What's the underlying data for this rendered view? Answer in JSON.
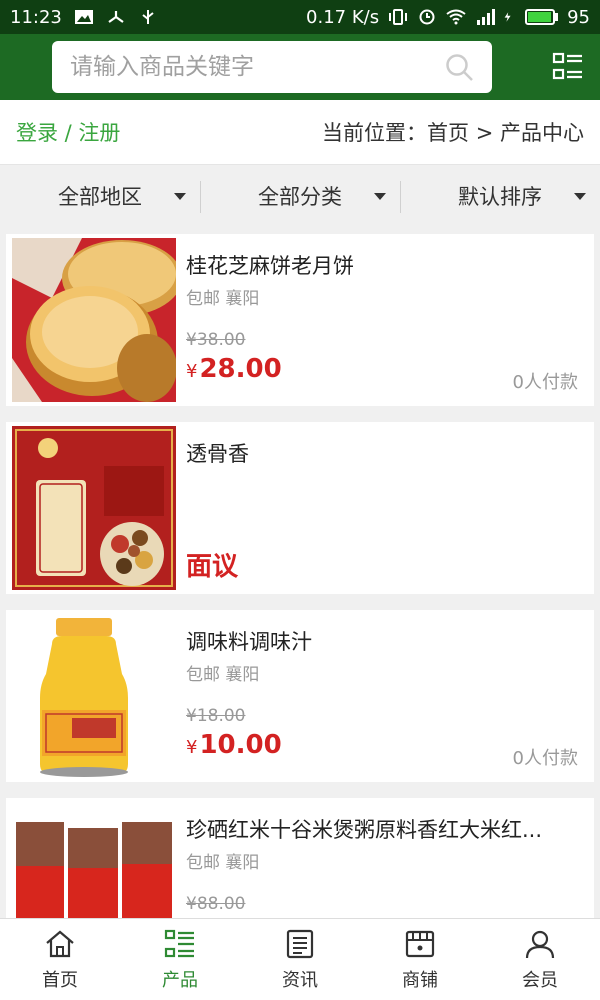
{
  "status": {
    "time": "11:23",
    "speed": "0.17 K/s",
    "battery": "95"
  },
  "search": {
    "placeholder": "请输入商品关键字"
  },
  "crumb": {
    "login": "登录 / 注册",
    "location": "当前位置：首页 > 产品中心"
  },
  "filters": [
    "全部地区",
    "全部分类",
    "默认排序"
  ],
  "products": [
    {
      "name": "桂花芝麻饼老月饼",
      "meta": "包邮 襄阳",
      "old_price": "¥38.00",
      "currency": "¥",
      "price": "28.00",
      "paid": "0人付款"
    },
    {
      "name": "透骨香",
      "negotiable": "面议"
    },
    {
      "name": "调味料调味汁",
      "meta": "包邮 襄阳",
      "old_price": "¥18.00",
      "currency": "¥",
      "price": "10.00",
      "paid": "0人付款"
    },
    {
      "name": "珍硒红米十谷米煲粥原料香红大米红...",
      "meta": "包邮 襄阳",
      "old_price": "¥88.00"
    }
  ],
  "tabs": [
    {
      "label": "首页"
    },
    {
      "label": "产品"
    },
    {
      "label": "资讯"
    },
    {
      "label": "商铺"
    },
    {
      "label": "会员"
    }
  ],
  "colors": {
    "header": "#1d6a23",
    "accent": "#2e8a33",
    "price": "#d32222"
  }
}
